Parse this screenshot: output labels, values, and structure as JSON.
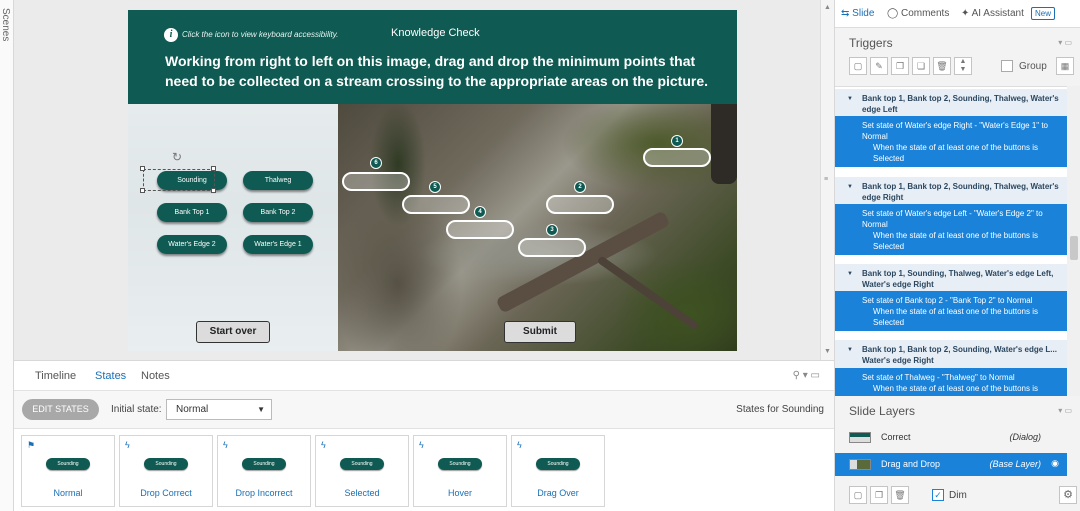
{
  "scenes_label": "Scenes",
  "slide": {
    "accessibility_hint": "Click the icon to view keyboard accessibility.",
    "info_glyph": "i",
    "title": "Knowledge Check",
    "instruction": "Working from right to left on this image, drag and drop the minimum points that need to be collected on a stream crossing to the appropriate areas on the picture.",
    "drag_items": [
      "Sounding",
      "Thalweg",
      "Bank Top 1",
      "Bank Top 2",
      "Water's Edge 2",
      "Water's Edge 1"
    ],
    "drop_numbers": [
      "1",
      "2",
      "3",
      "4",
      "5",
      "6"
    ],
    "start_over": "Start over",
    "submit": "Submit",
    "accent_color": "#0f5a52"
  },
  "bottom": {
    "tabs": [
      "Timeline",
      "States",
      "Notes"
    ],
    "active_tab": "States",
    "edit_states": "EDIT STATES",
    "initial_state_label": "Initial state:",
    "initial_state_value": "Normal",
    "states_for": "States for Sounding",
    "state_pill_text": "Sounding",
    "states": [
      "Normal",
      "Drop Correct",
      "Drop Incorrect",
      "Selected",
      "Hover",
      "Drag Over"
    ]
  },
  "right": {
    "tabs": {
      "slide": "Slide",
      "comments": "Comments",
      "ai": "AI Assistant",
      "new_badge": "New"
    },
    "triggers_title": "Triggers",
    "group_label": "Group",
    "triggers": [
      {
        "head": "Bank top 1, Bank top 2, Sounding, Thalweg, Water's edge Left",
        "action": "Set state of Water's edge Right - \"Water's Edge 1\" to Normal",
        "cond": "When the state of at least one of the buttons is Selected"
      },
      {
        "head": "Bank top 1, Bank top 2, Sounding, Thalweg, Water's edge Right",
        "action": "Set state of Water's edge Left - \"Water's Edge 2\" to Normal",
        "cond": "When the state of at least one of the buttons is Selected"
      },
      {
        "head": "Bank top 1, Sounding, Thalweg, Water's edge Left, Water's edge Right",
        "action": "Set state of Bank top 2 - \"Bank Top 2\" to Normal",
        "cond": "When the state of at least one of the buttons is Selected"
      },
      {
        "head": "Bank top 1, Bank top 2, Sounding, Water's edge L... Water's edge Right",
        "action": "Set state of Thalweg - \"Thalweg\" to Normal",
        "cond": "When the state of at least one of the buttons is"
      }
    ],
    "layers_title": "Slide Layers",
    "layers": [
      {
        "name": "Correct",
        "type": "(Dialog)"
      },
      {
        "name": "Drag and Drop",
        "type": "(Base Layer)"
      }
    ],
    "dim_label": "Dim",
    "selection_color": "#1a82d8"
  }
}
